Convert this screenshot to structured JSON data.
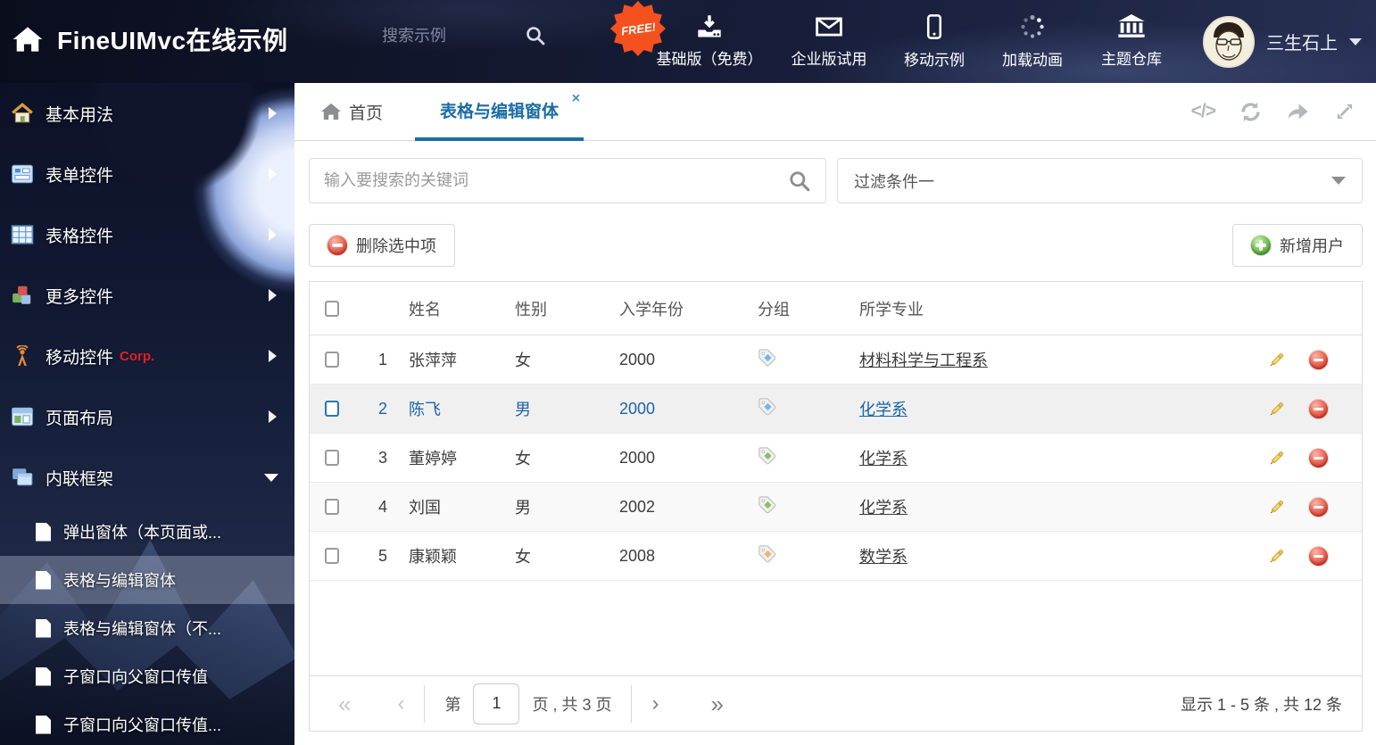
{
  "app": {
    "title": "FineUIMvc在线示例"
  },
  "header": {
    "search_placeholder": "搜索示例",
    "free_badge": "FREE!",
    "nav": [
      {
        "label": "基础版（免费）",
        "icon": "download-icon"
      },
      {
        "label": "企业版试用",
        "icon": "envelope-icon"
      },
      {
        "label": "移动示例",
        "icon": "mobile-icon"
      },
      {
        "label": "加载动画",
        "icon": "spinner-icon"
      },
      {
        "label": "主题仓库",
        "icon": "bank-icon"
      }
    ],
    "user_name": "三生石上"
  },
  "sidebar": {
    "menu": [
      {
        "label": "基本用法",
        "icon": "home-icon"
      },
      {
        "label": "表单控件",
        "icon": "form-icon"
      },
      {
        "label": "表格控件",
        "icon": "table-icon"
      },
      {
        "label": "更多控件",
        "icon": "cubes-icon"
      },
      {
        "label": "移动控件",
        "badge": "Corp.",
        "icon": "antenna-icon"
      },
      {
        "label": "页面布局",
        "icon": "layout-icon"
      },
      {
        "label": "内联框架",
        "icon": "frames-icon",
        "expanded": true
      }
    ],
    "submenu": [
      {
        "label": "弹出窗体（本页面或...",
        "selected": false
      },
      {
        "label": "表格与编辑窗体",
        "selected": true
      },
      {
        "label": "表格与编辑窗体（不...",
        "selected": false
      },
      {
        "label": "子窗口向父窗口传值",
        "selected": false
      },
      {
        "label": "子窗口向父窗口传值...",
        "selected": false
      }
    ]
  },
  "tabs": {
    "home_label": "首页",
    "active_label": "表格与编辑窗体",
    "close_icon": "×",
    "code_icon": "</>"
  },
  "filters": {
    "search_placeholder": "输入要搜索的关键词",
    "filter_value": "过滤条件一"
  },
  "toolbar": {
    "delete_label": "删除选中项",
    "add_label": "新增用户"
  },
  "table": {
    "columns": {
      "name": "姓名",
      "gender": "性别",
      "year": "入学年份",
      "group": "分组",
      "major": "所学专业"
    },
    "tag_colors": {
      "blue": "#6db8f2",
      "green": "#8cbf5f",
      "orange": "#f6b26e"
    },
    "rows": [
      {
        "num": "1",
        "name": "张萍萍",
        "gender": "女",
        "year": "2000",
        "tag": "blue",
        "major": "材料科学与工程系",
        "selected": false
      },
      {
        "num": "2",
        "name": "陈飞",
        "gender": "男",
        "year": "2000",
        "tag": "blue",
        "major": "化学系",
        "selected": true
      },
      {
        "num": "3",
        "name": "董婷婷",
        "gender": "女",
        "year": "2000",
        "tag": "green",
        "major": "化学系",
        "selected": false
      },
      {
        "num": "4",
        "name": "刘国",
        "gender": "男",
        "year": "2002",
        "tag": "green",
        "major": "化学系",
        "selected": false
      },
      {
        "num": "5",
        "name": "康颖颖",
        "gender": "女",
        "year": "2008",
        "tag": "orange",
        "major": "数学系",
        "selected": false
      }
    ]
  },
  "pagination": {
    "first_icon": "«",
    "prev_icon": "‹",
    "page_prefix": "第",
    "page_value": "1",
    "page_suffix": "页 , 共 3 页",
    "next_icon": "›",
    "last_icon": "»",
    "summary": "显示 1 - 5 条 , 共 12 条"
  },
  "colors": {
    "accent_blue": "#1b6ca8",
    "free_badge_orange": "#f4511e",
    "danger_red": "#d94330",
    "success_green": "#4f9e3b",
    "corp_red": "#e51f1f"
  }
}
